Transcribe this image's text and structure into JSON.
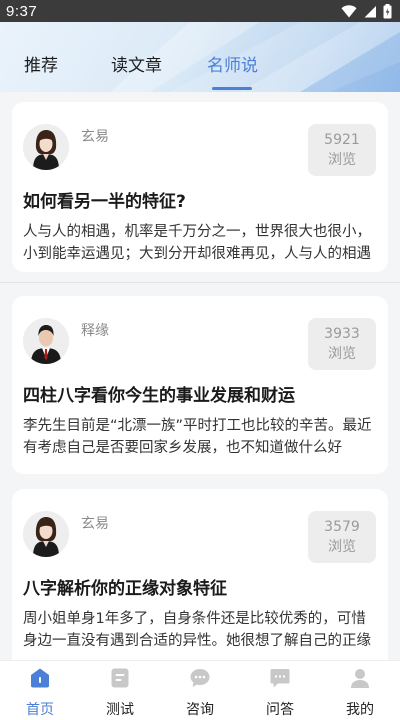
{
  "status_bar": {
    "time": "9:37"
  },
  "tabs": [
    {
      "label": "推荐",
      "active": false
    },
    {
      "label": "读文章",
      "active": false
    },
    {
      "label": "名师说",
      "active": true
    }
  ],
  "colors": {
    "accent": "#4c7fd6",
    "status_bar": "#3b3b3b",
    "views_badge": "#ededed"
  },
  "articles": [
    {
      "author": "玄易",
      "views_count": "5921",
      "views_label": "浏览",
      "title": "如何看另一半的特征?",
      "excerpt": "人与人的相遇，机率是千万分之一，世界很大也很小，小到能幸运遇见；大到分开却很难再见，人与人的相遇",
      "avatar": "female-teacher-avatar"
    },
    {
      "author": "释缘",
      "views_count": "3933",
      "views_label": "浏览",
      "title": "四柱八字看你今生的事业发展和财运",
      "excerpt": "李先生目前是“北漂一族”平时打工也比较的辛苦。最近有考虑自己是否要回家乡发展，也不知道做什么好",
      "avatar": "male-teacher-avatar"
    },
    {
      "author": "玄易",
      "views_count": "3579",
      "views_label": "浏览",
      "title": "八字解析你的正缘对象特征",
      "excerpt": "周小姐单身1年多了，自身条件还是比较优秀的，可惜身边一直没有遇到合适的异性。她很想了解自己的正缘",
      "avatar": "female-teacher-avatar"
    }
  ],
  "bottom_nav": [
    {
      "label": "首页",
      "icon": "home-icon",
      "active": true
    },
    {
      "label": "测试",
      "icon": "test-icon",
      "active": false
    },
    {
      "label": "咨询",
      "icon": "consult-icon",
      "active": false
    },
    {
      "label": "问答",
      "icon": "qa-icon",
      "active": false
    },
    {
      "label": "我的",
      "icon": "profile-icon",
      "active": false
    }
  ]
}
